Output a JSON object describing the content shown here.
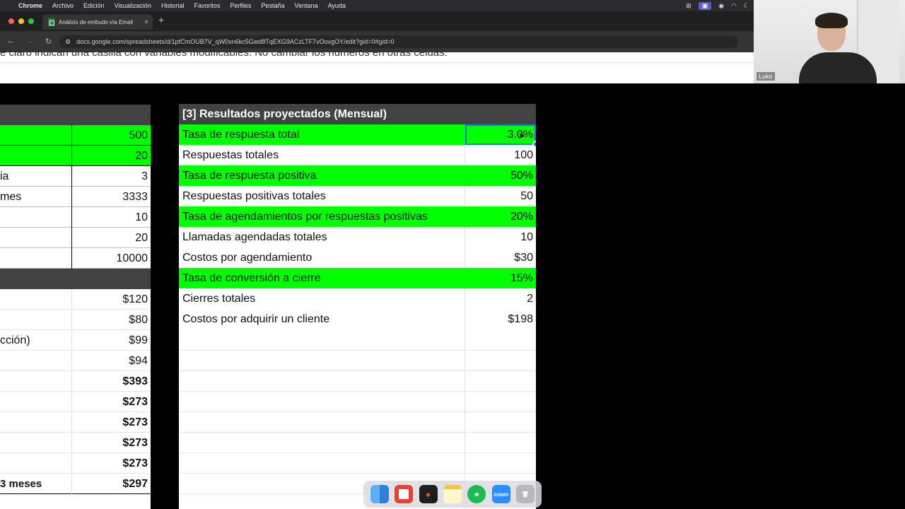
{
  "menubar": {
    "app": "Chrome",
    "items": [
      "Archivo",
      "Edición",
      "Visualización",
      "Historial",
      "Favoritos",
      "Perfiles",
      "Pestaña",
      "Ventana",
      "Ayuda"
    ]
  },
  "browser": {
    "tab_title": "Análisis de embudo vía Email",
    "url": "docs.google.com/spreadsheets/d/1pfCmOUB7V_qW0xn6kc5Gwd8TqEXG9ACzLTF7vOoxgOY/edit?gid=0#gid=0"
  },
  "banner_text": "e claro indican una casilla con variables modificables. No cambiar los numeros en otras celdas.",
  "video": {
    "name": "Luke"
  },
  "left_table": {
    "rows": [
      {
        "label": "",
        "value": "500",
        "green": true
      },
      {
        "label": "",
        "value": "20",
        "green": true
      },
      {
        "label": "ia",
        "value": "3",
        "green": false
      },
      {
        "label": " mes",
        "value": "3333",
        "green": false
      },
      {
        "label": "",
        "value": "10",
        "green": false
      },
      {
        "label": "",
        "value": "20",
        "green": false
      },
      {
        "label": "",
        "value": "10000",
        "green": false
      }
    ],
    "cost_rows": [
      {
        "label": "",
        "value": "$120",
        "bold": false
      },
      {
        "label": "",
        "value": "$80",
        "bold": false
      },
      {
        "label": "cción)",
        "value": "$99",
        "bold": false
      },
      {
        "label": "",
        "value": "$94",
        "bold": false
      },
      {
        "label": "",
        "value": "$393",
        "bold": true
      },
      {
        "label": "",
        "value": "$273",
        "bold": true
      },
      {
        "label": "",
        "value": "$273",
        "bold": true
      },
      {
        "label": "",
        "value": "$273",
        "bold": true
      },
      {
        "label": "",
        "value": "$273",
        "bold": true
      },
      {
        "label": "3 meses",
        "value": "$297",
        "bold": true
      }
    ]
  },
  "right_table": {
    "title": "[3] Resultados proyectados (Mensual)",
    "rows": [
      {
        "label": "Tasa de respuesta total",
        "value": "3.0%",
        "green": true
      },
      {
        "label": "Respuestas totales",
        "value": "100",
        "green": false
      },
      {
        "label": "Tasa de respuesta positiva",
        "value": "50%",
        "green": true
      },
      {
        "label": "Respuestas positivas totales",
        "value": "50",
        "green": false
      },
      {
        "label": "Tasa de agendamientos por respuestas positivas",
        "value": "20%",
        "green": true
      },
      {
        "label": "Llamadas agendadas totales",
        "value": "10",
        "green": false
      },
      {
        "label": "Costos por agendamiento",
        "value": "$30",
        "green": false
      },
      {
        "label": "Tasa de conversión a cierre",
        "value": "15%",
        "green": true
      },
      {
        "label": "Cierres totales",
        "value": "2",
        "green": false
      },
      {
        "label": "Costos por adquirir un cliente",
        "value": "$198",
        "green": false
      }
    ]
  },
  "dock": [
    "finder",
    "chrome",
    "figma",
    "notes",
    "spotify",
    "zoom",
    "trash"
  ],
  "colors": {
    "accent_green": "#00ff00",
    "header_gray": "#424242",
    "selection_blue": "#1a73e8"
  }
}
